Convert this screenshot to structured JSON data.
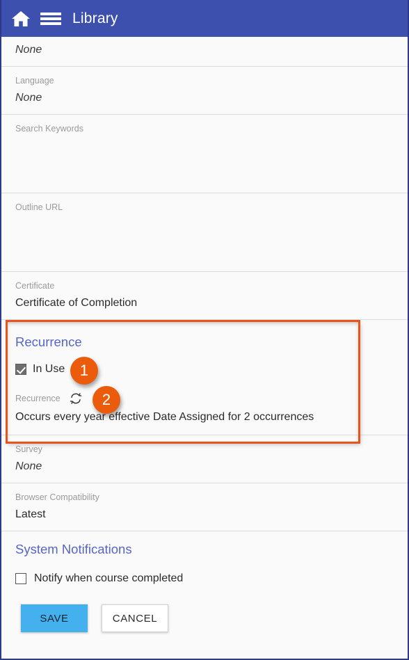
{
  "header": {
    "title": "Library",
    "home_icon": "home-icon",
    "menu_icon": "hamburger-menu-icon",
    "background_color": "#3d50ad"
  },
  "form": {
    "fields": [
      {
        "label": "",
        "value": "None",
        "italic": true,
        "truncated_top": true
      },
      {
        "label": "Language",
        "value": "None",
        "italic": true
      },
      {
        "label": "Search Keywords",
        "value": ""
      },
      {
        "label": "Outline URL",
        "value": ""
      },
      {
        "label": "Certificate",
        "value": "Certificate of Completion",
        "italic": false
      }
    ],
    "trailing_fields": [
      {
        "label": "Survey",
        "value": "None",
        "italic": true
      },
      {
        "label": "Browser Compatibility",
        "value": "Latest",
        "italic": false
      }
    ]
  },
  "recurrence_section": {
    "heading": "Recurrence",
    "in_use_label": "In Use",
    "in_use_checked": true,
    "recurrence_label": "Recurrence",
    "recurrence_icon": "refresh-recurrence-icon",
    "recurrence_description": "Occurs every year effective Date Assigned for 2 occurrences",
    "highlight_color": "#e8551a"
  },
  "annotations": [
    {
      "number": "1",
      "target": "in-use-checkbox"
    },
    {
      "number": "2",
      "target": "recurrence-icon"
    }
  ],
  "notifications_section": {
    "heading": "System Notifications",
    "notify_label": "Notify when course completed",
    "notify_checked": false
  },
  "actions": {
    "save_label": "SAVE",
    "cancel_label": "CANCEL",
    "save_color": "#45b0ee"
  },
  "theme": {
    "heading_blue": "#5566c4",
    "appbar_blue": "#3d50ad",
    "badge_orange": "#ea5b0c"
  }
}
